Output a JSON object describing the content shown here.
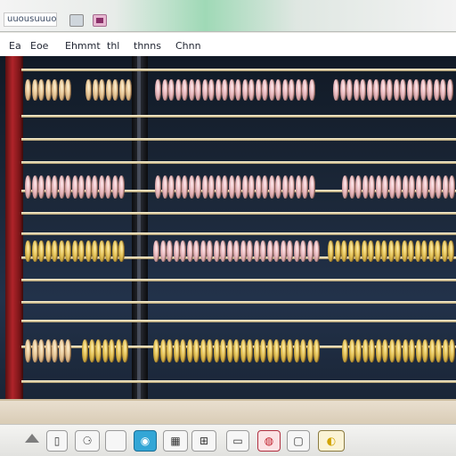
{
  "window": {
    "title": "uuousuuuo"
  },
  "menu": [
    {
      "label": "Ea"
    },
    {
      "label": "Eoe"
    },
    {
      "label": "Ehmmt"
    },
    {
      "label": "thl"
    },
    {
      "label": "thnns"
    },
    {
      "label": "Chnn"
    }
  ],
  "toolbar": {
    "icons": [
      {
        "name": "scroll-up-icon"
      },
      {
        "name": "document-icon",
        "glyph": "▯"
      },
      {
        "name": "gallery-icon",
        "glyph": "⚆"
      },
      {
        "name": "blank-icon",
        "glyph": ""
      },
      {
        "name": "camera-icon",
        "glyph": "◉"
      },
      {
        "name": "grid-icon",
        "glyph": "▦"
      },
      {
        "name": "apps-icon",
        "glyph": "⊞"
      },
      {
        "name": "window-icon",
        "glyph": "▭"
      },
      {
        "name": "record-icon",
        "glyph": "◍"
      },
      {
        "name": "square-icon",
        "glyph": "▢"
      },
      {
        "name": "moon-icon",
        "glyph": "◐"
      }
    ]
  },
  "colors": {
    "frame": "#b0242a",
    "bead": "#e6c696",
    "background": "#1b2738"
  }
}
